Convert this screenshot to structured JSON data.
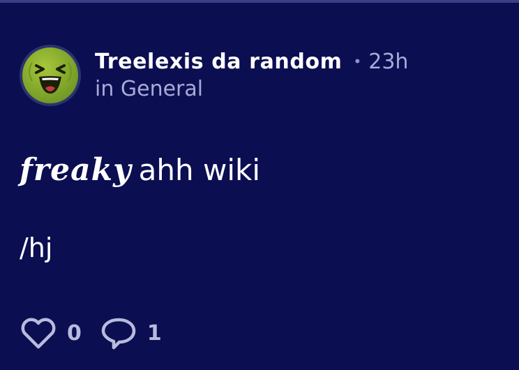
{
  "post": {
    "author": "Treelexis da random",
    "separator": "•",
    "time": "23h",
    "category": "in General",
    "title_styled": "𝒇𝒓𝒆𝒂𝒌𝒚",
    "title_plain": "ahh wiki",
    "body": "/hj",
    "likes": "0",
    "comments": "1"
  },
  "icons": {
    "avatar": "laughing-ball-avatar",
    "like": "heart-icon",
    "comment": "speech-bubble-icon"
  },
  "colors": {
    "background": "#0c0e52",
    "muted_text": "#a7abd6",
    "avatar_green": "#7fa52a"
  }
}
